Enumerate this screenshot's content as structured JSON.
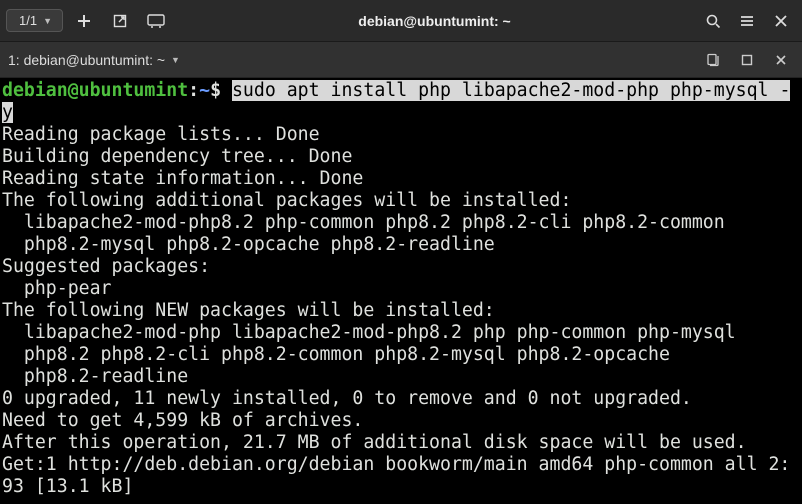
{
  "window": {
    "tab_counter": "1/1",
    "title": "debian@ubuntumint: ~"
  },
  "tabbar": {
    "label": "1: debian@ubuntumint: ~"
  },
  "terminal": {
    "prompt_user": "debian@ubuntumint",
    "prompt_path": "~",
    "prompt_symbol": "$",
    "command_hl1": "sudo apt install php libapache2-mod-php php-mysql -",
    "command_hl2": "y",
    "lines": [
      "Reading package lists... Done",
      "Building dependency tree... Done",
      "Reading state information... Done",
      "The following additional packages will be installed:",
      "  libapache2-mod-php8.2 php-common php8.2 php8.2-cli php8.2-common",
      "  php8.2-mysql php8.2-opcache php8.2-readline",
      "Suggested packages:",
      "  php-pear",
      "The following NEW packages will be installed:",
      "  libapache2-mod-php libapache2-mod-php8.2 php php-common php-mysql",
      "  php8.2 php8.2-cli php8.2-common php8.2-mysql php8.2-opcache",
      "  php8.2-readline",
      "0 upgraded, 11 newly installed, 0 to remove and 0 not upgraded.",
      "Need to get 4,599 kB of archives.",
      "After this operation, 21.7 MB of additional disk space will be used.",
      "Get:1 http://deb.debian.org/debian bookworm/main amd64 php-common all 2:",
      "93 [13.1 kB]"
    ]
  }
}
